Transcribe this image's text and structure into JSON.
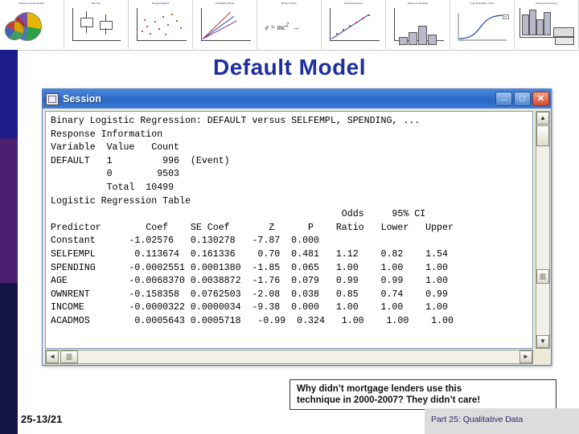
{
  "slide": {
    "title": "Default Model",
    "footer_number": "25-13/21",
    "footer_section": "Part 25: Qualitative Data"
  },
  "filmstrip": {
    "thumbs": [
      {
        "caption": "Discrete Choice Models",
        "kind": "pie"
      },
      {
        "caption": "Box Plot",
        "kind": "boxplot"
      },
      {
        "caption": "Marginal Effects",
        "kind": "scatter"
      },
      {
        "caption": "Probability Model",
        "kind": "lines"
      },
      {
        "caption": "Binary Choice",
        "kind": "formula"
      },
      {
        "caption": "Fitted Regression",
        "kind": "regline"
      },
      {
        "caption": "Data and Variables",
        "kind": "bars"
      },
      {
        "caption": "Logit Probability Curve",
        "kind": "curve"
      },
      {
        "caption": "Histogram Summary",
        "kind": "hist"
      }
    ]
  },
  "window": {
    "title": "Session",
    "icon": "session-window-icon",
    "buttons": {
      "minimize": "_",
      "maximize": "□",
      "close": "✕"
    },
    "scroll": {
      "up_arrow": "▲",
      "down_arrow": "▼",
      "left_arrow": "◄",
      "right_arrow": "►"
    },
    "console_text": "Binary Logistic Regression: DEFAULT versus SELFEMPL, SPENDING, ...\nResponse Information\nVariable  Value   Count\nDEFAULT   1         996  (Event)\n          0        9503\n          Total  10499\nLogistic Regression Table\n                                                    Odds     95% CI\nPredictor        Coef    SE Coef       Z      P    Ratio   Lower   Upper\nConstant      -1.02576   0.130278   -7.87  0.000\nSELFEMPL       0.113674  0.161336    0.70  0.481   1.12    0.82    1.54\nSPENDING      -0.0002551 0.0001380  -1.85  0.065   1.00    1.00    1.00\nAGE           -0.0068370 0.0038872  -1.76  0.079   0.99    0.99    1.00\nOWNRENT       -0.158358  0.0762503  -2.08  0.038   0.85    0.74    0.99\nINCOME        -0.0000322 0.0000034  -9.38  0.000   1.00    1.00    1.00\nACADMOS        0.0005643 0.0005718   -0.99  0.324   1.00    1.00    1.00"
  },
  "callout": {
    "line1": "Why didn’t mortgage lenders use this",
    "line2": "technique in 2000-2007?  They didn’t care!"
  }
}
